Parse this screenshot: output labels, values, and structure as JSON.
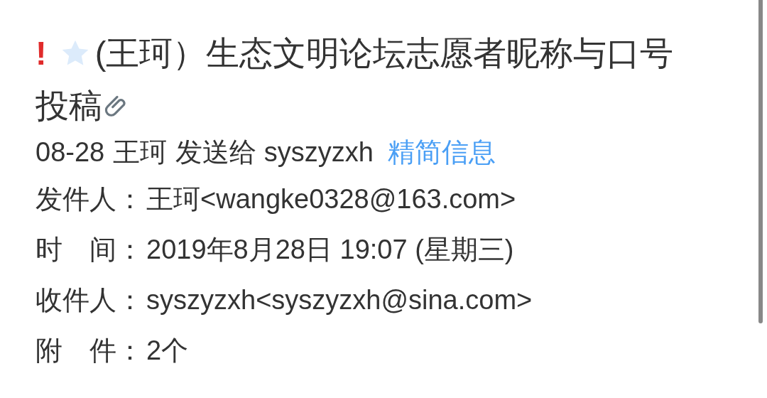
{
  "title": {
    "flag": "!",
    "starred": false,
    "text_lines": [
      "(王珂）生态文明论坛志愿者昵称与口号",
      "投稿"
    ],
    "has_attachment": true
  },
  "summary": {
    "date": "08-28",
    "sender": "王珂",
    "sent_to": "发送给 syszyzxh",
    "link": "精简信息"
  },
  "fields": [
    {
      "label": "发件人：",
      "value": "王珂<wangke0328@163.com>"
    },
    {
      "label": "时　间：",
      "value": "2019年8月28日 19:07 (星期三)"
    },
    {
      "label": "收件人：",
      "value": "syszyzxh<syszyzxh@sina.com>"
    },
    {
      "label": "附　件：",
      "value": "2个"
    }
  ]
}
